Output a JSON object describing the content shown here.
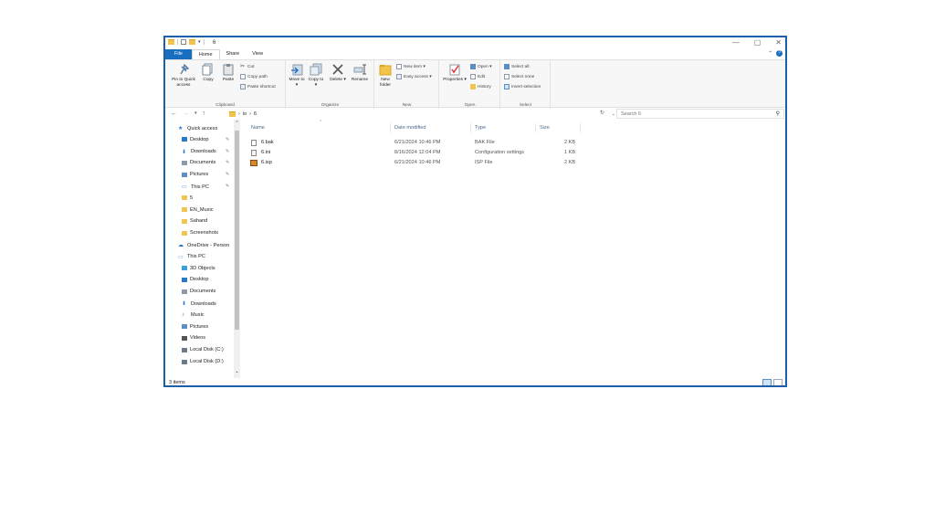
{
  "title_bar": {
    "title": "6",
    "minimize": "—",
    "maximize": "▢",
    "close": "✕"
  },
  "tabs": [
    "File",
    "Home",
    "Share",
    "View"
  ],
  "ribbon": {
    "clipboard": {
      "pin_label": "Pin to Quick access",
      "copy_label": "Copy",
      "paste_label": "Paste",
      "cut_label": "Cut",
      "copy_path_label": "Copy path",
      "paste_shortcut_label": "Paste shortcut",
      "group_label": "Clipboard"
    },
    "organize": {
      "move_to_label": "Move to ▾",
      "copy_to_label": "Copy to ▾",
      "delete_label": "Delete ▾",
      "rename_label": "Rename",
      "group_label": "Organize"
    },
    "new": {
      "new_folder_label": "New folder",
      "new_item_label": "New item ▾",
      "easy_access_label": "Easy access ▾",
      "group_label": "New"
    },
    "open": {
      "properties_label": "Properties ▾",
      "open_label": "Open ▾",
      "edit_label": "Edit",
      "history_label": "History",
      "group_label": "Open"
    },
    "select": {
      "select_all_label": "Select all",
      "select_none_label": "Select none",
      "invert_selection_label": "Invert selection",
      "group_label": "Select"
    }
  },
  "address_bar": {
    "back": "←",
    "forward": "→",
    "recent": "▾",
    "up": "↑",
    "path_segments": [
      "io",
      "6"
    ],
    "search_placeholder": "Search 6"
  },
  "nav_pane": {
    "items": [
      {
        "label": "Quick access",
        "icon": "star-icon",
        "pinned": false
      },
      {
        "label": "Desktop",
        "icon": "desktop-icon",
        "pinned": true
      },
      {
        "label": "Downloads",
        "icon": "download-icon",
        "pinned": true
      },
      {
        "label": "Documents",
        "icon": "documents-icon",
        "pinned": true
      },
      {
        "label": "Pictures",
        "icon": "pictures-icon",
        "pinned": true
      },
      {
        "label": "This PC",
        "icon": "computer-icon",
        "pinned": true
      },
      {
        "label": "5",
        "icon": "folder-icon",
        "pinned": false
      },
      {
        "label": "EN_Music",
        "icon": "folder-icon",
        "pinned": false
      },
      {
        "label": "Sahand",
        "icon": "folder-icon",
        "pinned": false
      },
      {
        "label": "Screenshots",
        "icon": "folder-icon",
        "pinned": false
      },
      {
        "label": "OneDrive - Person",
        "icon": "cloud-icon",
        "pinned": false
      },
      {
        "label": "This PC",
        "icon": "computer-icon",
        "pinned": false
      },
      {
        "label": "3D Objects",
        "icon": "cube-icon",
        "pinned": false
      },
      {
        "label": "Desktop",
        "icon": "desktop-icon",
        "pinned": false
      },
      {
        "label": "Documents",
        "icon": "documents-icon",
        "pinned": false
      },
      {
        "label": "Downloads",
        "icon": "download-icon",
        "pinned": false
      },
      {
        "label": "Music",
        "icon": "music-icon",
        "pinned": false
      },
      {
        "label": "Pictures",
        "icon": "pictures-icon",
        "pinned": false
      },
      {
        "label": "Videos",
        "icon": "videos-icon",
        "pinned": false
      },
      {
        "label": "Local Disk (C:)",
        "icon": "drive-icon",
        "pinned": false
      },
      {
        "label": "Local Disk (D:)",
        "icon": "drive-icon",
        "pinned": false
      }
    ],
    "pin_glyph": "📌"
  },
  "columns": [
    "Name",
    "Date modified",
    "Type",
    "Size"
  ],
  "files": [
    {
      "name": "6.bak",
      "date": "6/21/2024 10:46 PM",
      "type": "BAK File",
      "size": "2 KB",
      "icon": "file-icon"
    },
    {
      "name": "6.ini",
      "date": "8/16/2024 12:04 PM",
      "type": "Configuration settings",
      "size": "1 KB",
      "icon": "settings-file-icon"
    },
    {
      "name": "6.isp",
      "date": "6/21/2024 10:46 PM",
      "type": "ISP File",
      "size": "2 KB",
      "icon": "package-icon"
    }
  ],
  "status_bar": {
    "item_count": "3 items"
  },
  "colors": {
    "accent": "#1a6ec0",
    "border": "#1a5fa8",
    "folder": "#f1c44d"
  }
}
